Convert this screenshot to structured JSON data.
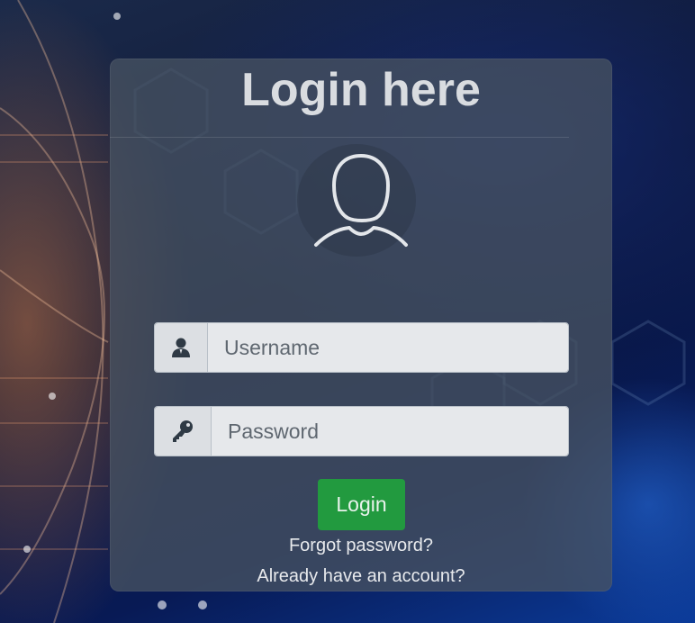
{
  "page": {
    "title": "Login here"
  },
  "form": {
    "username": {
      "placeholder": "Username",
      "value": "",
      "icon": "user-icon"
    },
    "password": {
      "placeholder": "Password",
      "value": "",
      "icon": "key-icon"
    },
    "login_label": "Login"
  },
  "links": {
    "forgot": "Forgot password?",
    "account": "Already have an account?"
  },
  "colors": {
    "login_button": "#229a3f",
    "card": "#465262"
  },
  "avatar_icon": "user-avatar-icon"
}
